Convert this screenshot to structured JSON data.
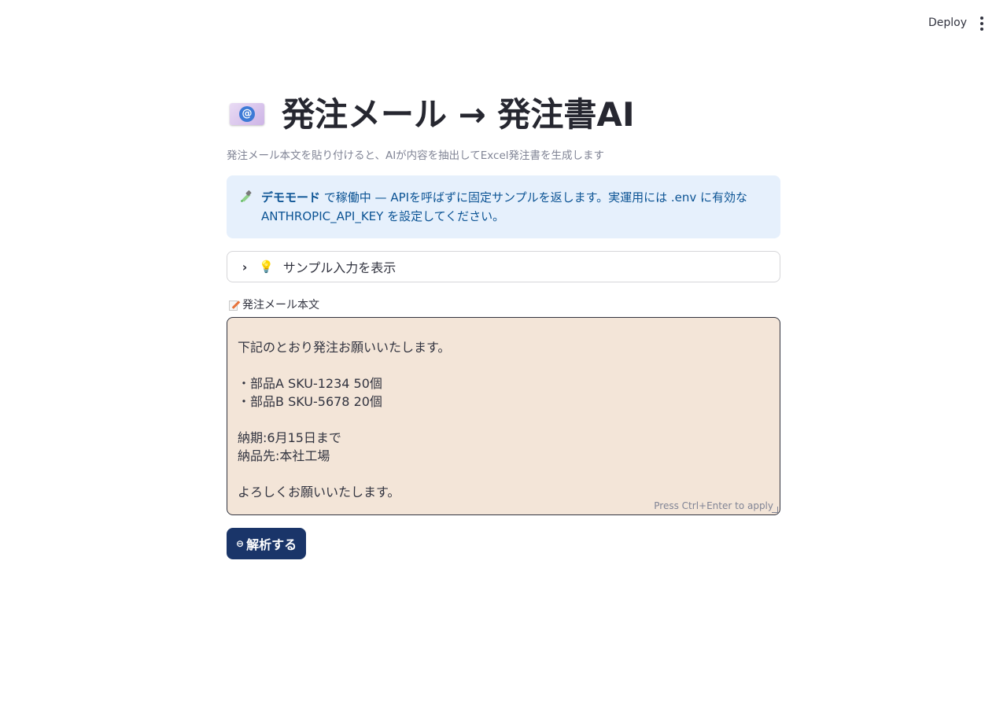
{
  "header": {
    "deploy_label": "Deploy"
  },
  "page": {
    "title": "発注メール → 発注書AI",
    "subtitle": "発注メール本文を貼り付けると、AIが内容を抽出してExcel発注書を生成します"
  },
  "info": {
    "bold": "デモモード",
    "text": " で稼働中 — APIを呼ばずに固定サンプルを返します。実運用には .env に有効な ANTHROPIC_API_KEY を設定してください。"
  },
  "expander": {
    "label": "サンプル入力を表示"
  },
  "form": {
    "label": "発注メール本文",
    "value": "下記のとおり発注お願いいたします。\n\n・部品A SKU-1234 50個\n・部品B SKU-5678 20個\n\n納期:6月15日まで\n納品先:本社工場\n\nよろしくお願いいたします。",
    "hint": "Press Ctrl+Enter to apply",
    "submit_label": "解析する"
  },
  "colors": {
    "info_bg": "#e6f0fc",
    "info_text": "#0b5394",
    "textarea_bg": "#f3e5d8",
    "button_bg": "#1a3569"
  }
}
